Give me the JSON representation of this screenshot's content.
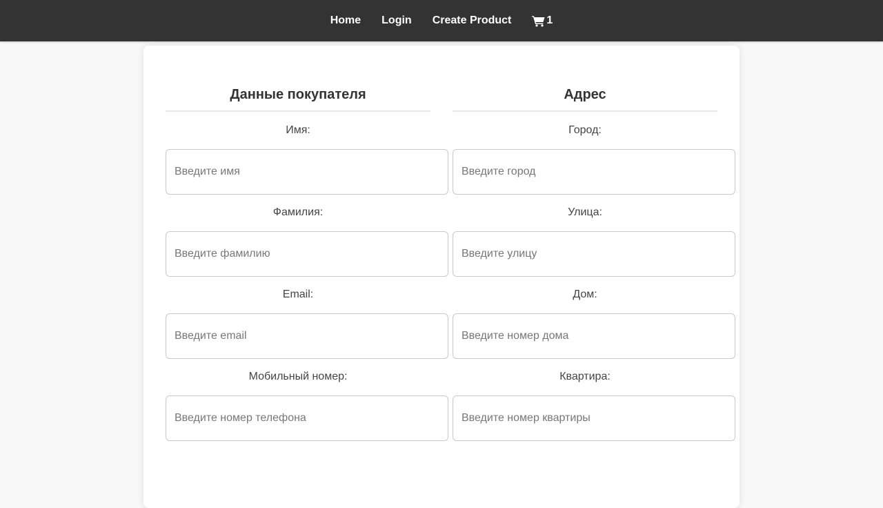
{
  "nav": {
    "home": "Home",
    "login": "Login",
    "create_product": "Create Product",
    "cart_count": "1"
  },
  "buyer": {
    "title": "Данные покупателя",
    "fields": [
      {
        "label": "Имя:",
        "placeholder": "Введите имя",
        "value": ""
      },
      {
        "label": "Фамилия:",
        "placeholder": "Введите фамилию",
        "value": ""
      },
      {
        "label": "Email:",
        "placeholder": "Введите email",
        "value": ""
      },
      {
        "label": "Мобильный номер:",
        "placeholder": "Введите номер телефона",
        "value": ""
      }
    ]
  },
  "address": {
    "title": "Адрес",
    "fields": [
      {
        "label": "Город:",
        "placeholder": "Введите город",
        "value": ""
      },
      {
        "label": "Улица:",
        "placeholder": "Введите улицу",
        "value": ""
      },
      {
        "label": "Дом:",
        "placeholder": "Введите номер дома",
        "value": ""
      },
      {
        "label": "Квартира:",
        "placeholder": "Введите номер квартиры",
        "value": ""
      }
    ]
  },
  "colors": {
    "navbar_bg": "#333333",
    "page_bg": "#f8f8f8",
    "card_bg": "#ffffff"
  },
  "icons": {
    "cart": "shopping-cart-icon"
  }
}
